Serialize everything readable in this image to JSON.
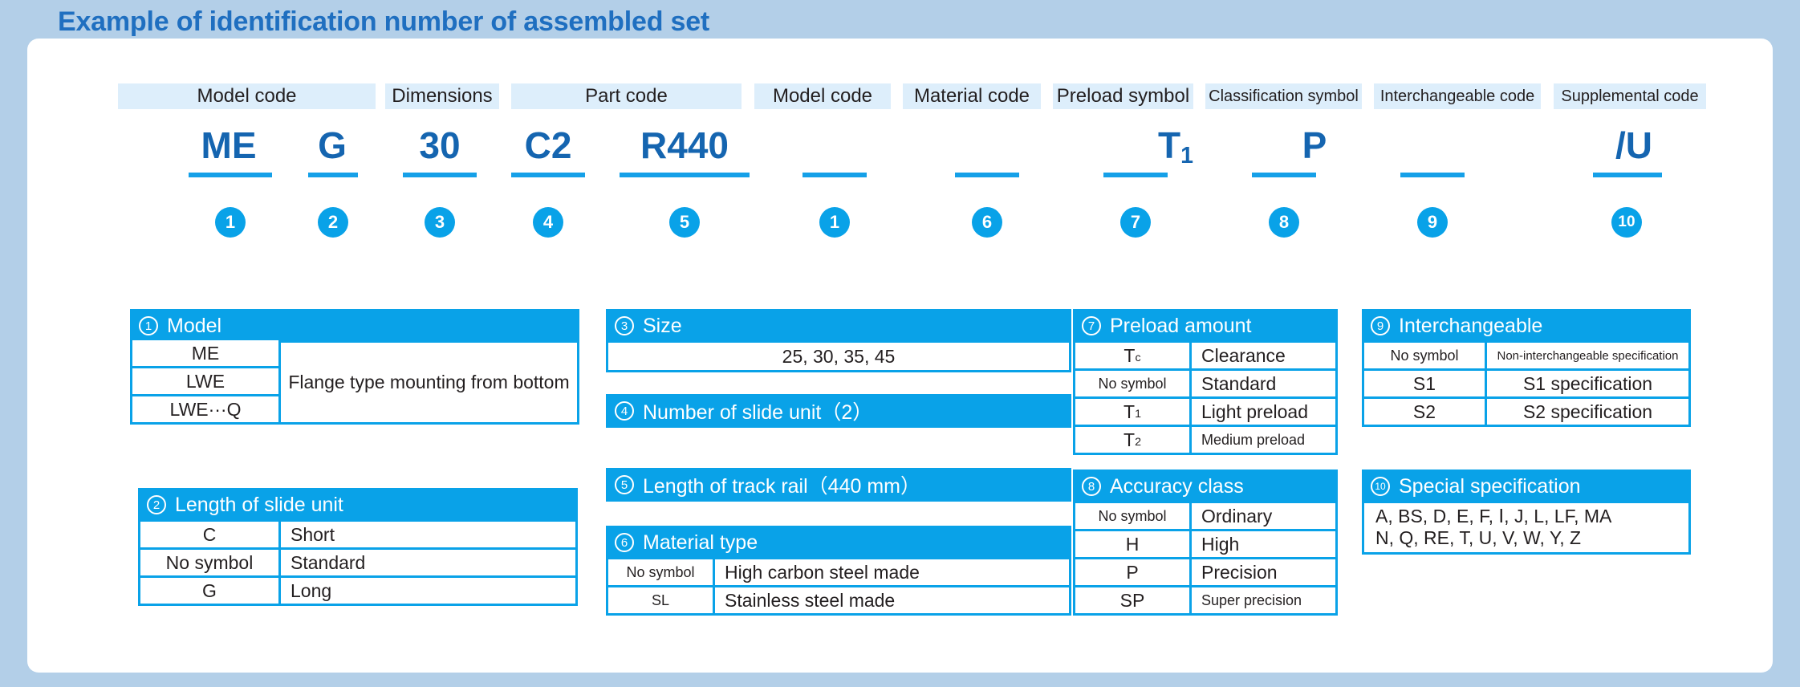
{
  "title": "Example of identification number of assembled set",
  "code_line": {
    "labels": [
      {
        "text": "Model code"
      },
      {
        "text": "Dimensions"
      },
      {
        "text": "Part code"
      },
      {
        "text": "Model code"
      },
      {
        "text": "Material code"
      },
      {
        "text": "Preload symbol"
      },
      {
        "text": "Classification symbol"
      },
      {
        "text": "Interchangeable code"
      },
      {
        "text": "Supplemental code"
      }
    ],
    "segments": [
      {
        "value": "ME",
        "badge": "1"
      },
      {
        "value": "G",
        "badge": "2"
      },
      {
        "value": "30",
        "badge": "3"
      },
      {
        "value": "C2",
        "badge": "4"
      },
      {
        "value": "R440",
        "badge": "5"
      },
      {
        "value": "",
        "badge": "1"
      },
      {
        "value": "",
        "badge": "6"
      },
      {
        "value": "T",
        "value_sub": "1",
        "badge": "7"
      },
      {
        "value": "P",
        "badge": "8"
      },
      {
        "value": "",
        "badge": "9"
      },
      {
        "value": "/U",
        "badge": "10"
      }
    ]
  },
  "tables": {
    "model": {
      "badge": "1",
      "title": "Model",
      "keys": [
        "ME",
        "LWE",
        "LWE···Q"
      ],
      "merged_value": "Flange type mounting from bottom"
    },
    "slide_length": {
      "badge": "2",
      "title": "Length of slide unit",
      "rows": [
        {
          "key": "C",
          "value": "Short"
        },
        {
          "key": "No symbol",
          "value": "Standard"
        },
        {
          "key": "G",
          "value": "Long"
        }
      ]
    },
    "size": {
      "badge": "3",
      "title": "Size",
      "value": "25, 30, 35, 45"
    },
    "slide_count": {
      "badge": "4",
      "title": "Number of slide unit（2）"
    },
    "rail_length": {
      "badge": "5",
      "title": "Length of track rail（440 mm）"
    },
    "material": {
      "badge": "6",
      "title": "Material type",
      "rows": [
        {
          "key": "No symbol",
          "value": "High carbon steel made"
        },
        {
          "key": "SL",
          "value": "Stainless steel made"
        }
      ]
    },
    "preload": {
      "badge": "7",
      "title": "Preload amount",
      "rows": [
        {
          "key": "Tc",
          "key_base": "T",
          "key_sub": "c",
          "value": "Clearance"
        },
        {
          "key": "No symbol",
          "value": "Standard"
        },
        {
          "key": "T1",
          "key_base": "T",
          "key_sub": "1",
          "value": "Light preload"
        },
        {
          "key": "T2",
          "key_base": "T",
          "key_sub": "2",
          "value": "Medium preload"
        }
      ]
    },
    "accuracy": {
      "badge": "8",
      "title": "Accuracy class",
      "rows": [
        {
          "key": "No symbol",
          "value": "Ordinary"
        },
        {
          "key": "H",
          "value": "High"
        },
        {
          "key": "P",
          "value": "Precision"
        },
        {
          "key": "SP",
          "value": "Super precision"
        }
      ]
    },
    "interchangeable": {
      "badge": "9",
      "title": "Interchangeable",
      "rows": [
        {
          "key": "No symbol",
          "value": "Non-interchangeable specification"
        },
        {
          "key": "S1",
          "value": "S1 specification"
        },
        {
          "key": "S2",
          "value": "S2 specification"
        }
      ]
    },
    "special": {
      "badge": "10",
      "title": "Special specification",
      "line1": "A, BS, D, E, F, Ⅰ, J, L, LF, MA",
      "line2": "N, Q, RE, T, U, V, W, Y, Z"
    }
  },
  "colors": {
    "accent": "#09a2e8",
    "title": "#1f6fc0",
    "code": "#1565b0",
    "label_bg": "#ddeefb",
    "page_band": "#b3cfe8"
  }
}
